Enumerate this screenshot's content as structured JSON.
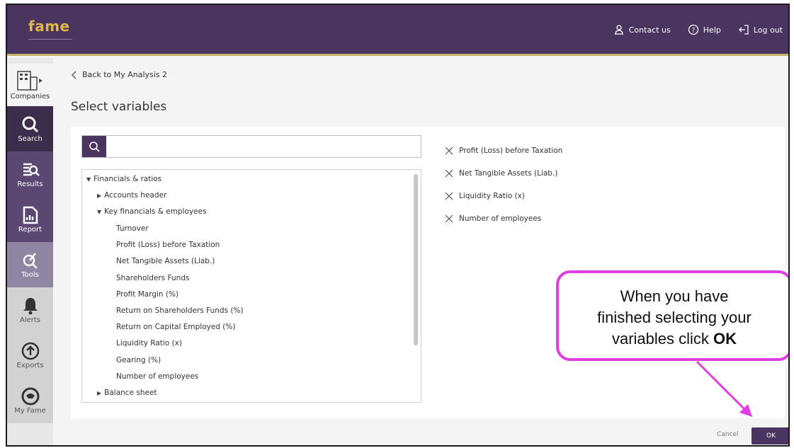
{
  "header": {
    "logo": "fame",
    "nav": [
      {
        "label": "Contact us",
        "icon": "person-icon"
      },
      {
        "label": "Help",
        "icon": "help-icon"
      },
      {
        "label": "Log out",
        "icon": "logout-icon"
      }
    ]
  },
  "sidebar": {
    "items": [
      {
        "label": "Companies",
        "icon": "building-icon"
      },
      {
        "label": "Search",
        "icon": "search-icon"
      },
      {
        "label": "Results",
        "icon": "results-icon"
      },
      {
        "label": "Report",
        "icon": "report-icon"
      },
      {
        "label": "Tools",
        "icon": "tools-icon"
      },
      {
        "label": "Alerts",
        "icon": "bell-icon"
      },
      {
        "label": "Exports",
        "icon": "upload-icon"
      },
      {
        "label": "My Fame",
        "icon": "profile-icon"
      }
    ]
  },
  "page": {
    "back_label": "Back to My Analysis 2",
    "title": "Select variables",
    "search_placeholder": ""
  },
  "tree": {
    "root": "Financials & ratios",
    "accounts_header": "Accounts header",
    "key_group": "Key financials & employees",
    "items": [
      {
        "label": "Turnover",
        "selected": false
      },
      {
        "label": "Profit (Loss) before Taxation",
        "selected": true
      },
      {
        "label": "Net Tangible Assets (Liab.)",
        "selected": true
      },
      {
        "label": "Shareholders Funds",
        "selected": false
      },
      {
        "label": "Profit Margin (%)",
        "selected": false
      },
      {
        "label": "Return on Shareholders Funds (%)",
        "selected": false
      },
      {
        "label": "Return on Capital Employed (%)",
        "selected": false
      },
      {
        "label": "Liquidity Ratio (x)",
        "selected": true
      },
      {
        "label": "Gearing (%)",
        "selected": false
      },
      {
        "label": "Number of employees",
        "selected": true
      }
    ],
    "balance_sheet": "Balance sheet"
  },
  "selected_variables": [
    "Profit (Loss) before Taxation",
    "Net Tangible Assets (Liab.)",
    "Liquidity Ratio (x)",
    "Number of employees"
  ],
  "callout": {
    "line1": "When you have",
    "line2": "finished selecting your",
    "line3_prefix": "variables click ",
    "line3_bold": "OK"
  },
  "footer": {
    "cancel_label": "Cancel",
    "ok_label": "OK"
  },
  "colors": {
    "header_bg": "#4a3560",
    "accent_gold": "#e0b74a",
    "check_green": "#3cb371",
    "callout_border": "#e03ee0"
  }
}
